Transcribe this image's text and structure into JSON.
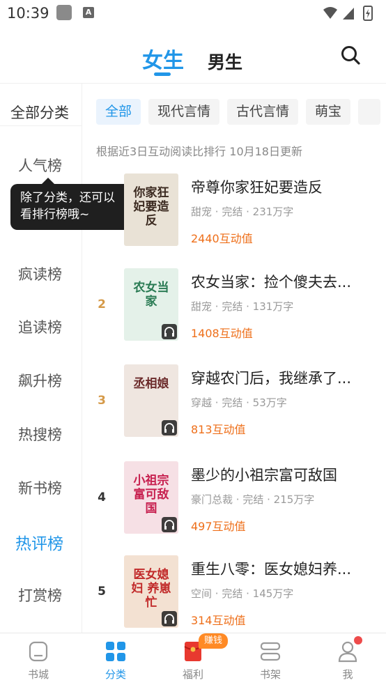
{
  "status_bar": {
    "time": "10:39",
    "a_glyph": "A"
  },
  "top_tabs": {
    "female": "女生",
    "male": "男生"
  },
  "sidebar": {
    "all_label": "全部分类",
    "items": [
      {
        "label": "人气榜"
      },
      {
        "label": "疯读榜"
      },
      {
        "label": "追读榜"
      },
      {
        "label": "飙升榜"
      },
      {
        "label": "热搜榜"
      },
      {
        "label": "新书榜"
      },
      {
        "label": "热评榜"
      },
      {
        "label": "打赏榜"
      }
    ]
  },
  "tooltip": {
    "line1": "除了分类，还可以",
    "line2": "看排行榜哦~"
  },
  "chips": [
    "全部",
    "现代言情",
    "古代言情",
    "萌宝"
  ],
  "rank_note": "根据近3日互动阅读比排行 10月18日更新",
  "books": [
    {
      "rank": "",
      "title": "帝尊你家狂妃要造反",
      "genre": "甜宠",
      "status": "完结",
      "words": "231万字",
      "score": "2440互动值",
      "cover_text": "你家狂妃要造反",
      "cover_color": "#e9e2d6",
      "cover_ink": "#3b2a20"
    },
    {
      "rank": "2",
      "title": "农女当家：捡个傻夫去...",
      "genre": "甜宠",
      "status": "完结",
      "words": "131万字",
      "score": "1408互动值",
      "cover_text": "农女当家",
      "cover_color": "#e4f1e9",
      "cover_ink": "#2a7b54"
    },
    {
      "rank": "3",
      "title": "穿越农门后，我继承了...",
      "genre": "穿越",
      "status": "完结",
      "words": "53万字",
      "score": "813互动值",
      "cover_text": "丞相娘",
      "cover_color": "#efe6e0",
      "cover_ink": "#6b2a2a"
    },
    {
      "rank": "4",
      "title": "墨少的小祖宗富可敌国",
      "genre": "豪门总裁",
      "status": "完结",
      "words": "215万字",
      "score": "497互动值",
      "cover_text": "小祖宗 富可敌国",
      "cover_color": "#f6e0e5",
      "cover_ink": "#c7204f"
    },
    {
      "rank": "5",
      "title": "重生八零：医女媳妇养...",
      "genre": "空间",
      "status": "完结",
      "words": "145万字",
      "score": "314互动值",
      "cover_text": "医女媳妇 养崽忙",
      "cover_color": "#f3e1d2",
      "cover_ink": "#c12a2a"
    }
  ],
  "bottom_nav": {
    "items": [
      {
        "label": "书城"
      },
      {
        "label": "分类"
      },
      {
        "label": "福利"
      },
      {
        "label": "书架"
      },
      {
        "label": "我"
      }
    ],
    "earn_badge": "赚钱"
  },
  "colors": {
    "accent": "#2196e8",
    "score": "#ee6f1a",
    "rank_gold": "#d59a49",
    "badge": "#ff8a25"
  }
}
